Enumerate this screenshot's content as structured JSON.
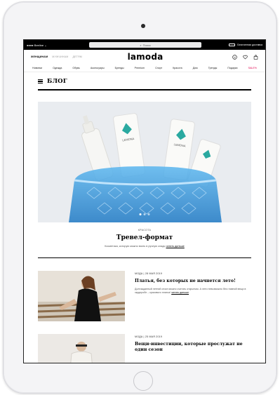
{
  "browser": {
    "status_left": "●●●● Beeline ⌄",
    "url": "Поиск",
    "status_right": "Бесплатная доставка"
  },
  "header": {
    "genders": [
      "ЖЕНЩИНАМ",
      "МУЖЧИНАМ",
      "ДЕТЯМ"
    ],
    "logo": "lamoda",
    "icons": [
      "smile-icon",
      "heart-icon",
      "bag-icon"
    ]
  },
  "categories": [
    "Новинки",
    "Одежда",
    "Обувь",
    "Аксессуары",
    "Бренды",
    "Premium",
    "Спорт",
    "Красота",
    "Дом",
    "Тренды",
    "Подарки",
    "SALE%"
  ],
  "blog": {
    "title": "БЛОГ"
  },
  "hero": {
    "category": "КРАСОТА",
    "title": "Тревел-формат",
    "description": "Косметика, которую можно взять в ручную кладь",
    "link": "читать дальше"
  },
  "articles": [
    {
      "meta": "МОДА | 28 МАЯ 2019",
      "title": "Платья, без которых не начнется лето!",
      "description": "Долгожданный летний сезон можно считать открытым. А лето невозможно без главной вещи в гардеробе – красивого платья!",
      "link": "читать дальше"
    },
    {
      "meta": "МОДА | 25 МАЯ 2019",
      "title": "Вещи-инвестиции, которые прослужат не один сезон",
      "description": "",
      "link": ""
    }
  ],
  "colors": {
    "accent": "#e0004d",
    "text": "#000000",
    "bag": "#2f8fd6"
  }
}
